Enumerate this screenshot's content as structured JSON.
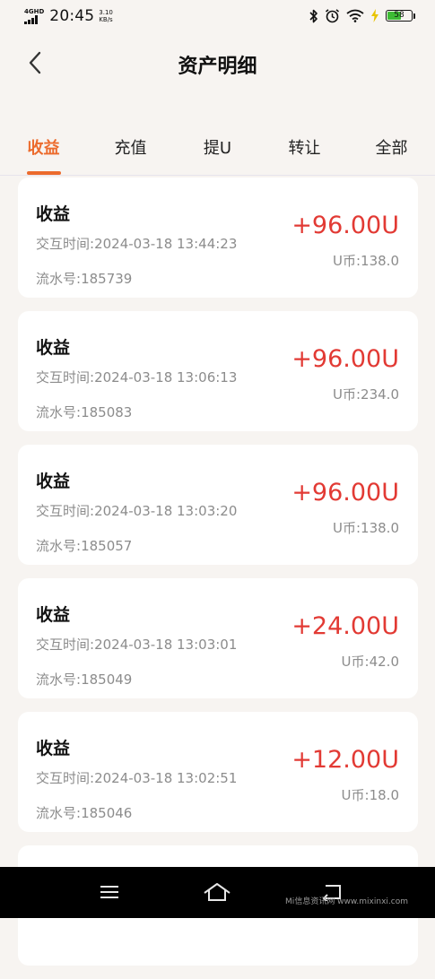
{
  "status_bar": {
    "network_type": "4GHD",
    "time": "20:45",
    "speed_value": "3.10",
    "speed_unit": "KB/s",
    "battery_level": "58"
  },
  "header": {
    "title": "资产明细"
  },
  "tabs": [
    {
      "label": "收益",
      "active": true
    },
    {
      "label": "充值",
      "active": false
    },
    {
      "label": "提U",
      "active": false
    },
    {
      "label": "转让",
      "active": false
    },
    {
      "label": "全部",
      "active": false
    }
  ],
  "labels": {
    "time_prefix": "交互时间:",
    "serial_prefix": "流水号:",
    "balance_prefix": "U币:"
  },
  "records": [
    {
      "type": "收益",
      "time": "2024-03-18 13:44:23",
      "serial": "185739",
      "amount": "+96.00U",
      "balance": "138.0"
    },
    {
      "type": "收益",
      "time": "2024-03-18 13:06:13",
      "serial": "185083",
      "amount": "+96.00U",
      "balance": "234.0"
    },
    {
      "type": "收益",
      "time": "2024-03-18 13:03:20",
      "serial": "185057",
      "amount": "+96.00U",
      "balance": "138.0"
    },
    {
      "type": "收益",
      "time": "2024-03-18 13:03:01",
      "serial": "185049",
      "amount": "+24.00U",
      "balance": "42.0"
    },
    {
      "type": "收益",
      "time": "2024-03-18 13:02:51",
      "serial": "185046",
      "amount": "+12.00U",
      "balance": "18.0"
    }
  ],
  "watermark": "Mi信息资讯网 www.mixinxi.com",
  "colors": {
    "accent": "#ec6b2d",
    "amount": "#e23a34",
    "battery": "#3dbb34"
  }
}
